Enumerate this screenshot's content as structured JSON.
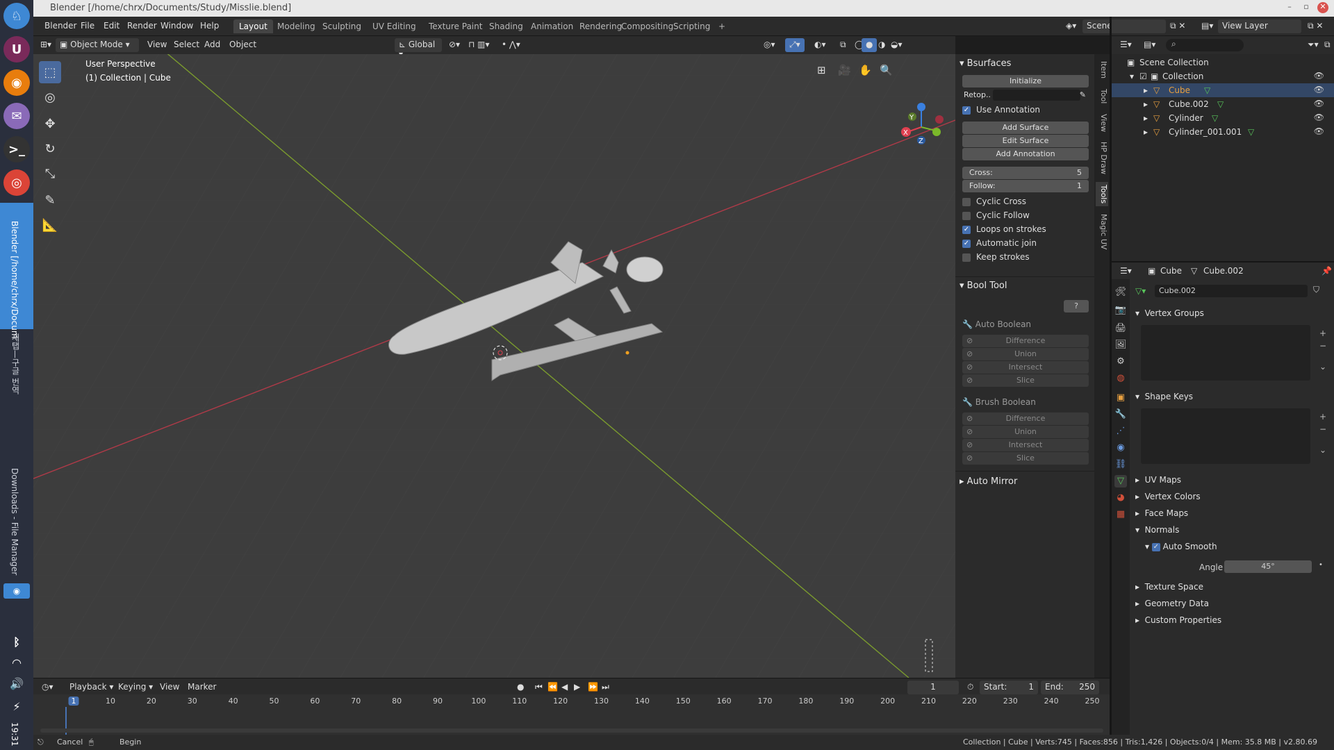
{
  "window": {
    "title": "Blender [/home/chrx/Documents/Study/Misslie.blend]"
  },
  "dock": {
    "active_app_text": "Blender [/home/chrx/Docum",
    "vertical_text_2": "새탭—구글 번역",
    "vertical_text_3": "Downloads - File Manager",
    "clock": "19:31"
  },
  "menubar": {
    "items": [
      "Blender",
      "File",
      "Edit",
      "Render",
      "Window",
      "Help"
    ],
    "workspaces": [
      "Layout",
      "Modeling",
      "Sculpting",
      "UV Editing",
      "Texture Paint",
      "Shading",
      "Animation",
      "Rendering",
      "Compositing",
      "Scripting"
    ],
    "add_tab": "+",
    "scene": "Scene",
    "view_layer": "View Layer"
  },
  "viewport_header": {
    "mode": "Object Mode",
    "menus": [
      "View",
      "Select",
      "Add",
      "Object"
    ],
    "orientation": "Global"
  },
  "viewport": {
    "perspective": "User Perspective",
    "collection": "(1) Collection | Cube"
  },
  "npanel": {
    "tabs": [
      "Item",
      "Tool",
      "View",
      "HP Draw",
      "Tools",
      "Magic UV"
    ],
    "bsurfaces": {
      "title": "Bsurfaces",
      "initialize": "Initialize",
      "retop_label": "Retop..",
      "use_annotation": "Use Annotation",
      "add_surface": "Add Surface",
      "edit_surface": "Edit Surface",
      "add_annotation": "Add Annotation",
      "cross_label": "Cross:",
      "cross_value": "5",
      "follow_label": "Follow:",
      "follow_value": "1",
      "cyclic_cross": "Cyclic Cross",
      "cyclic_follow": "Cyclic Follow",
      "loops_on_strokes": "Loops on strokes",
      "automatic_join": "Automatic join",
      "keep_strokes": "Keep strokes"
    },
    "booltool": {
      "title": "Bool Tool",
      "help": "?",
      "auto_boolean": "Auto Boolean",
      "brush_boolean": "Brush Boolean",
      "ops": [
        "Difference",
        "Union",
        "Intersect",
        "Slice"
      ]
    },
    "auto_mirror": "Auto Mirror"
  },
  "outliner": {
    "root": "Scene Collection",
    "collection": "Collection",
    "objects": [
      "Cube",
      "Cube.002",
      "Cylinder",
      "Cylinder_001.001"
    ]
  },
  "properties": {
    "breadcrumb_object": "Cube",
    "breadcrumb_mesh": "Cube.002",
    "mesh_name": "Cube.002",
    "sections": {
      "vertex_groups": "Vertex Groups",
      "shape_keys": "Shape Keys",
      "uv_maps": "UV Maps",
      "vertex_colors": "Vertex Colors",
      "face_maps": "Face Maps",
      "normals": "Normals",
      "auto_smooth": "Auto Smooth",
      "angle_label": "Angle",
      "angle_value": "45°",
      "texture_space": "Texture Space",
      "geometry_data": "Geometry Data",
      "custom_properties": "Custom Properties"
    }
  },
  "timeline": {
    "menus": [
      "Playback",
      "Keying",
      "View",
      "Marker"
    ],
    "current_frame": "1",
    "start_label": "Start:",
    "start_value": "1",
    "end_label": "End:",
    "end_value": "250",
    "ticks": [
      "1",
      "10",
      "20",
      "30",
      "40",
      "50",
      "60",
      "70",
      "80",
      "90",
      "100",
      "110",
      "120",
      "130",
      "140",
      "150",
      "160",
      "170",
      "180",
      "190",
      "200",
      "210",
      "220",
      "230",
      "240",
      "250"
    ]
  },
  "statusbar": {
    "cancel": "Cancel",
    "begin": "Begin",
    "info": "Collection | Cube | Verts:745 | Faces:856 | Tris:1,426 | Objects:0/4 | Mem: 35.8 MB | v2.80.69"
  },
  "colors": {
    "accent": "#4772b3",
    "object_orange": "#e8a040",
    "mesh_green": "#58c45a",
    "axis_x": "#e04050",
    "axis_y": "#7ab82a",
    "axis_z": "#3a80e0"
  }
}
